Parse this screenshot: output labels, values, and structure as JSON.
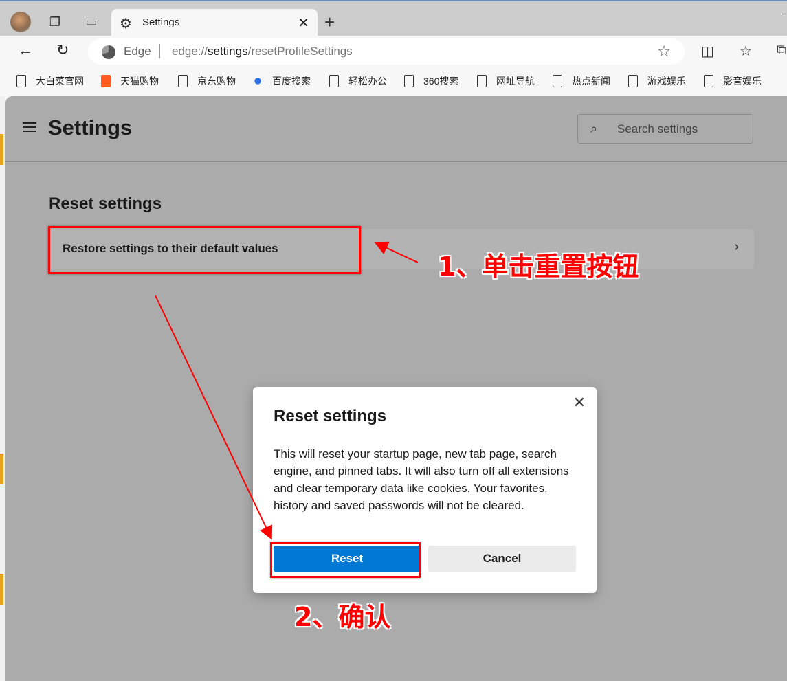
{
  "browser": {
    "tab_title": "Settings",
    "address_prefix": "Edge",
    "url_scheme": "edge://",
    "url_host": "settings",
    "url_path": "/resetProfileSettings",
    "bookmarks": [
      "大白菜官网",
      "天猫购物",
      "京东购物",
      "百度搜索",
      "轻松办公",
      "360搜索",
      "网址导航",
      "热点新闻",
      "游戏娱乐",
      "影音娱乐"
    ]
  },
  "settings": {
    "title": "Settings",
    "search_placeholder": "Search settings",
    "section_title": "Reset settings",
    "restore_item": "Restore settings to their default values"
  },
  "dialog": {
    "title": "Reset settings",
    "body": "This will reset your startup page, new tab page, search engine, and pinned tabs. It will also turn off all extensions and clear temporary data like cookies. Your favorites, history and saved passwords will not be cleared.",
    "reset_label": "Reset",
    "cancel_label": "Cancel"
  },
  "annotations": {
    "step1": "1、单击重置按钮",
    "step2": "2、确认"
  },
  "colors": {
    "accent": "#0078d4",
    "annotation": "#ff0000"
  }
}
